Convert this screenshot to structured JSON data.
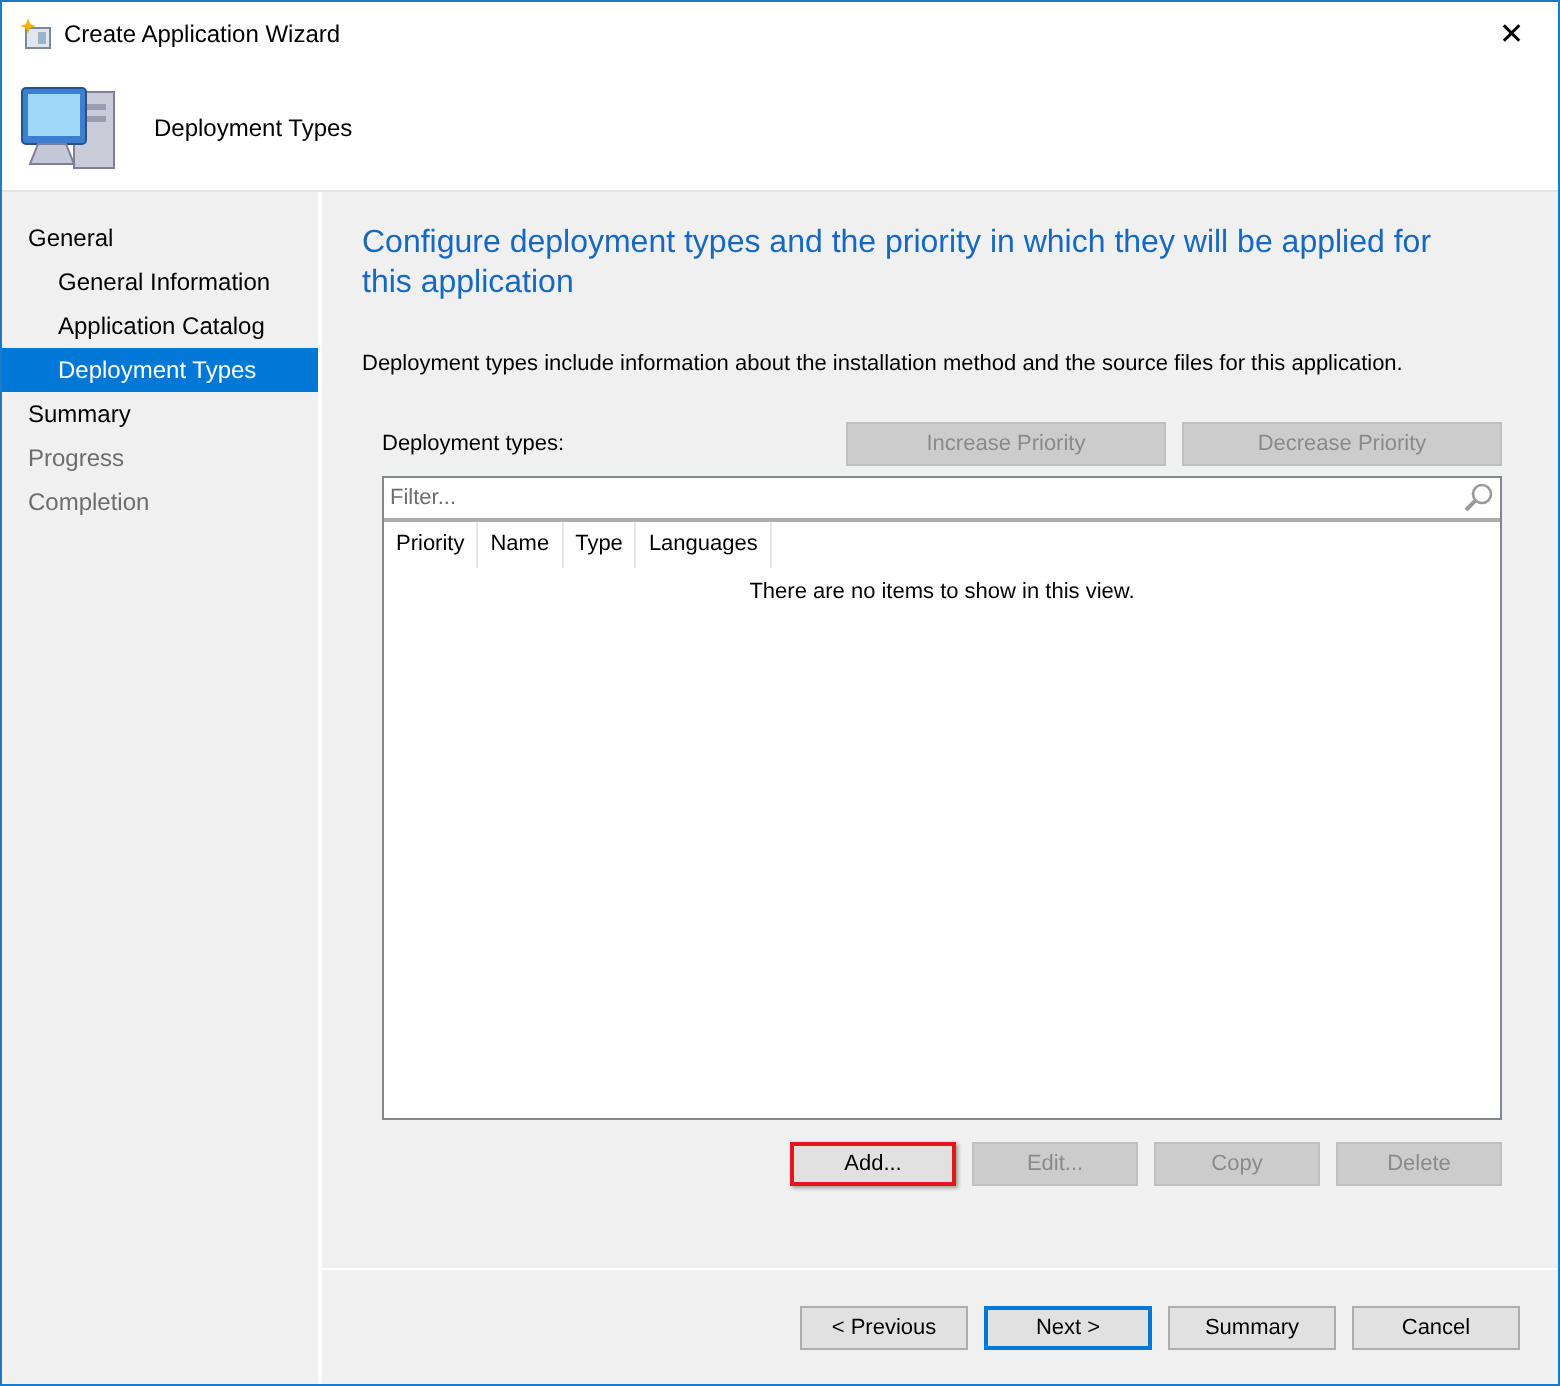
{
  "window": {
    "title": "Create Application Wizard",
    "close_label": "✕"
  },
  "header": {
    "title": "Deployment Types"
  },
  "sidebar": {
    "items": [
      {
        "label": "General",
        "selected": false,
        "disabled": false,
        "children": [
          {
            "label": "General Information",
            "selected": false,
            "disabled": false
          },
          {
            "label": "Application Catalog",
            "selected": false,
            "disabled": false
          },
          {
            "label": "Deployment Types",
            "selected": true,
            "disabled": false
          }
        ]
      },
      {
        "label": "Summary",
        "selected": false,
        "disabled": false
      },
      {
        "label": "Progress",
        "selected": false,
        "disabled": true
      },
      {
        "label": "Completion",
        "selected": false,
        "disabled": true
      }
    ]
  },
  "main": {
    "heading": "Configure deployment types and the priority in which they will be applied for this application",
    "description": "Deployment types include information about the installation method and the source files for this application.",
    "list_label": "Deployment types:",
    "priority_buttons": [
      {
        "label": "Increase Priority",
        "disabled": true
      },
      {
        "label": "Decrease Priority",
        "disabled": true
      }
    ],
    "filter": {
      "placeholder": "Filter..."
    },
    "table": {
      "columns": [
        "Priority",
        "Name",
        "Type",
        "Languages"
      ],
      "empty_message": "There are no items to show in this view."
    },
    "action_buttons": [
      {
        "label": "Add...",
        "disabled": false,
        "highlighted": true
      },
      {
        "label": "Edit...",
        "disabled": true,
        "highlighted": false
      },
      {
        "label": "Copy",
        "disabled": true,
        "highlighted": false
      },
      {
        "label": "Delete",
        "disabled": true,
        "highlighted": false
      }
    ]
  },
  "footer": {
    "buttons": [
      {
        "label": "< Previous",
        "default": false
      },
      {
        "label": "Next >",
        "default": true
      },
      {
        "label": "Summary",
        "default": false
      },
      {
        "label": "Cancel",
        "default": false
      }
    ]
  }
}
